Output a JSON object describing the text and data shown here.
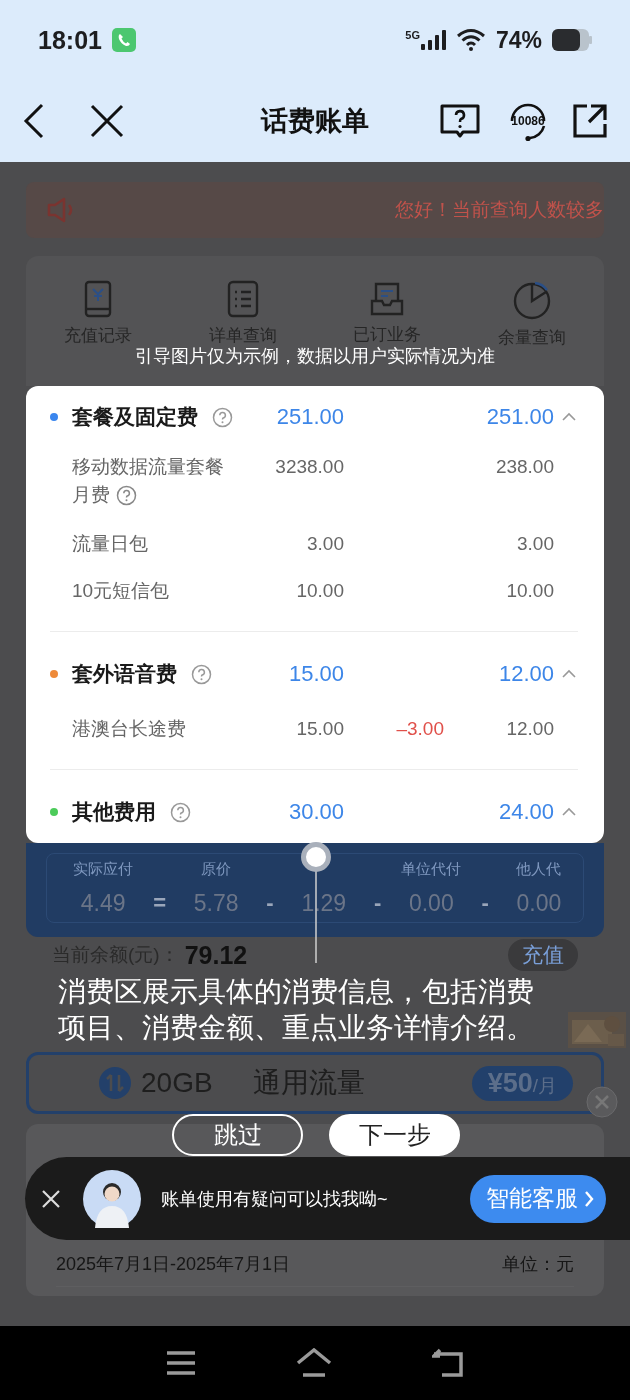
{
  "status_bar": {
    "time": "18:01",
    "network": "5G",
    "battery": "74%"
  },
  "nav": {
    "title": "话费账单",
    "hotline": "10086"
  },
  "notice": {
    "text": "您好！当前查询人数较多"
  },
  "quick_actions": [
    {
      "label": "充值记录"
    },
    {
      "label": "详单查询"
    },
    {
      "label": "已订业务"
    },
    {
      "label": "余量查询"
    }
  ],
  "guide_hint": "引导图片仅为示例，数据以用户实际情况为准",
  "fee_sections": [
    {
      "title": "套餐及固定费",
      "color": "#3a86ee",
      "amount": "251.00",
      "actual": "251.00",
      "expanded": true,
      "items": [
        {
          "name": "移动数据流量套餐月费",
          "help": true,
          "original": "3238.00",
          "actual": "238.00"
        },
        {
          "name": "流量日包",
          "help": false,
          "original": "3.00",
          "actual": "3.00"
        },
        {
          "name": "10元短信包",
          "help": false,
          "original": "10.00",
          "actual": "10.00"
        }
      ]
    },
    {
      "title": "套外语音费",
      "color": "#ee8a3a",
      "amount": "15.00",
      "actual": "12.00",
      "expanded": true,
      "items": [
        {
          "name": "港澳台长途费",
          "help": false,
          "original": "15.00",
          "adjustment": "–3.00",
          "actual": "12.00"
        }
      ]
    },
    {
      "title": "其他费用",
      "color": "#4ccb5a",
      "amount": "30.00",
      "actual": "24.00",
      "expanded": true
    }
  ],
  "summary": {
    "columns": [
      {
        "label": "实际应付",
        "value": "4.49"
      },
      {
        "label": "原价",
        "value": "5.78"
      },
      {
        "value": "1.29"
      },
      {
        "label": "单位代付",
        "value": "0.00"
      },
      {
        "label": "他人代",
        "value": "0.00"
      }
    ],
    "operators": [
      "=",
      "-",
      "-",
      "-"
    ]
  },
  "balance": {
    "label": "当前余额(元)：",
    "value": "79.12",
    "action": "充值"
  },
  "traffic_offer": {
    "amount": "20GB",
    "name": "通用流量",
    "price": "¥50",
    "unit": "/月"
  },
  "guide": {
    "text": "消费区展示具体的消费信息，包括消费项目、消费金额、重点业务详情介绍。",
    "buttons": [
      {
        "label": "跳过",
        "kind": "secondary"
      },
      {
        "label": "下一步",
        "kind": "primary"
      }
    ]
  },
  "bill_detail": {
    "period": "2025年7月1日-2025年7月1日",
    "unit": "单位：元"
  },
  "assistant": {
    "message": "账单使用有疑问可以找我呦~",
    "button": "智能客服"
  }
}
